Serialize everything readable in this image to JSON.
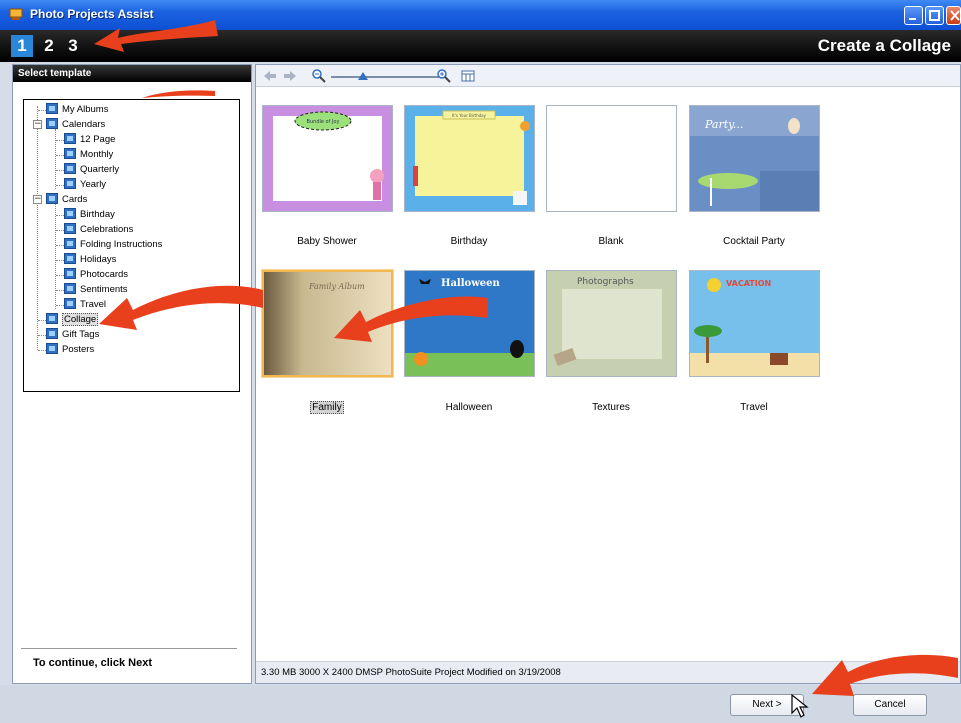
{
  "window": {
    "title": "Photo Projects Assist",
    "steps": [
      "1",
      "2",
      "3"
    ],
    "active_step": "1",
    "step_title": "Create a Collage"
  },
  "left_panel": {
    "header": "Select template",
    "tree": [
      {
        "label": "My Albums"
      },
      {
        "label": "Calendars"
      },
      {
        "label": "12 Page"
      },
      {
        "label": "Monthly"
      },
      {
        "label": "Quarterly"
      },
      {
        "label": "Yearly"
      },
      {
        "label": "Cards"
      },
      {
        "label": "Birthday"
      },
      {
        "label": "Celebrations"
      },
      {
        "label": "Folding Instructions"
      },
      {
        "label": "Holidays"
      },
      {
        "label": "Photocards"
      },
      {
        "label": "Sentiments"
      },
      {
        "label": "Travel"
      },
      {
        "label": "Collage"
      },
      {
        "label": "Gift Tags"
      },
      {
        "label": "Posters"
      }
    ],
    "selected": "Collage",
    "continue_text": "To continue, click Next"
  },
  "templates": [
    {
      "label": "Baby Shower",
      "thumb_text": "Bundle of Joy"
    },
    {
      "label": "Birthday",
      "thumb_text": "It's Your Birthday"
    },
    {
      "label": "Blank",
      "thumb_text": ""
    },
    {
      "label": "Cocktail Party",
      "thumb_text": "Party..."
    },
    {
      "label": "Family",
      "thumb_text": "Family Album"
    },
    {
      "label": "Halloween",
      "thumb_text": "Halloween"
    },
    {
      "label": "Textures",
      "thumb_text": "Photographs"
    },
    {
      "label": "Travel",
      "thumb_text": "VACATION"
    }
  ],
  "selected_template": "Family",
  "zoom_level": 0.3,
  "status_text": "3.30 MB   3000 X 2400   DMSP   PhotoSuite Project Modified on 3/19/2008",
  "buttons": {
    "next": "Next >",
    "cancel": "Cancel"
  },
  "colors": {
    "title_bar": "#0d4fd3",
    "step_active": "#2a86d8",
    "selection": "#f2b84f",
    "arrow": "#e8401c"
  }
}
